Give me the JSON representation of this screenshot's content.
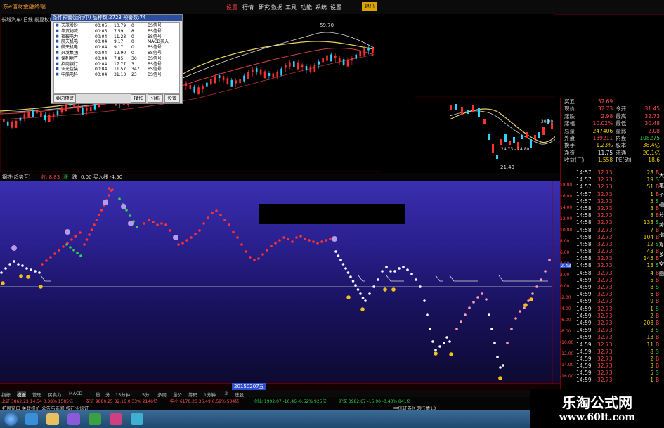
{
  "app": {
    "title": "东e信财金融终端",
    "window_button": "退出"
  },
  "menu": {
    "items": [
      "设置",
      "行情",
      "研究",
      "数据",
      "工具",
      "功能",
      "系统",
      "设置"
    ],
    "active_index": 0
  },
  "chart_top": {
    "title": "长城汽车(日线 前复权)",
    "high_label": "59.70",
    "low_label": "21.43",
    "range_label": "24.73 - 24.80",
    "price_labels": [
      "29.00"
    ]
  },
  "popup": {
    "title": "条件预警(运行中) 品种数:2723 预警数:74",
    "rows": [
      {
        "name": "天茂股份",
        "time": "00:05",
        "v1": "10.79",
        "v2": "0",
        "sig": "BS信号"
      },
      {
        "name": "华贸物流",
        "time": "00:05",
        "v1": "7.59",
        "v2": "8",
        "sig": "BS信号"
      },
      {
        "name": "福鞍电力",
        "time": "00:04",
        "v1": "11.23",
        "v2": "0",
        "sig": "BS信号"
      },
      {
        "name": "航天机电",
        "time": "00:04",
        "v1": "9.17",
        "v2": "0",
        "sig": "MACD买入"
      },
      {
        "name": "航天机电",
        "time": "00:04",
        "v1": "9.17",
        "v2": "0",
        "sig": "BS信号"
      },
      {
        "name": "兴发集团",
        "time": "00:04",
        "v1": "12.90",
        "v2": "0",
        "sig": "BS信号"
      },
      {
        "name": "保利地产",
        "time": "00:04",
        "v1": "7.85",
        "v2": "36",
        "sig": "BS信号"
      },
      {
        "name": "招商银行",
        "time": "00:04",
        "v1": "17.77",
        "v2": "3",
        "sig": "BS信号"
      },
      {
        "name": "亚光包装",
        "time": "00:04",
        "v1": "11.57",
        "v2": "347",
        "sig": "BS信号"
      },
      {
        "name": "中船电科",
        "time": "00:04",
        "v1": "31.13",
        "v2": "23",
        "sig": "BS信号"
      }
    ],
    "buttons": [
      "关闭预警",
      "操作",
      "分析",
      "设置"
    ]
  },
  "quote": [
    [
      "买五",
      "32.69",
      "",
      ""
    ],
    [
      "现价",
      "32.73",
      "今开",
      "31.45"
    ],
    [
      "涨跌",
      "2.98",
      "最高",
      "32.73"
    ],
    [
      "涨幅",
      "10.02%",
      "最低",
      "30.48"
    ],
    [
      "总量",
      "247406",
      "量比",
      "2.08"
    ],
    [
      "外盘",
      "139211",
      "内盘",
      "108275"
    ],
    [
      "换手",
      "1.23%",
      "股本",
      "38.4亿"
    ],
    [
      "净资",
      "11.75",
      "流通",
      "20.1亿"
    ],
    [
      "收益(三)",
      "1.558",
      "PE(动)",
      "18.6"
    ]
  ],
  "ticks": [
    [
      "14:57",
      "32.73",
      "28"
    ],
    [
      "14:57",
      "32.73",
      "19"
    ],
    [
      "14:57",
      "32.73",
      "51"
    ],
    [
      "14:57",
      "32.73",
      "1"
    ],
    [
      "14:57",
      "32.73",
      "5"
    ],
    [
      "14:58",
      "32.73",
      "3"
    ],
    [
      "14:58",
      "32.73",
      "8"
    ],
    [
      "14:58",
      "32.73",
      "133"
    ],
    [
      "14:58",
      "32.73",
      "7"
    ],
    [
      "14:58",
      "32.73",
      "104"
    ],
    [
      "14:58",
      "32.73",
      "12"
    ],
    [
      "14:58",
      "32.73",
      "43"
    ],
    [
      "14:58",
      "32.73",
      "145"
    ],
    [
      "14:58",
      "32.73",
      "13"
    ],
    [
      "14:58",
      "32.73",
      "4"
    ],
    [
      "14:59",
      "32.73",
      "5"
    ],
    [
      "14:59",
      "32.73",
      "8"
    ],
    [
      "14:59",
      "32.73",
      "6"
    ],
    [
      "14:59",
      "32.73",
      "9"
    ],
    [
      "14:59",
      "32.73",
      "1"
    ],
    [
      "14:59",
      "32.73",
      "2"
    ],
    [
      "14:59",
      "32.73",
      "208"
    ],
    [
      "14:59",
      "32.73",
      "3"
    ],
    [
      "14:59",
      "32.73",
      "13"
    ],
    [
      "14:59",
      "32.73",
      "11"
    ],
    [
      "14:59",
      "32.73",
      "8"
    ],
    [
      "14:59",
      "32.73",
      "2"
    ],
    [
      "14:59",
      "32.73",
      "3"
    ],
    [
      "14:59",
      "32.73",
      "5"
    ],
    [
      "14:59",
      "32.73",
      "1"
    ]
  ],
  "side_tabs": [
    "大",
    "笔",
    "价",
    "细",
    "分",
    "势",
    "指",
    "筹",
    "多",
    "空",
    "图"
  ],
  "indicator": {
    "title": "钢铁(趋势互)",
    "legend": [
      "收: 8.83",
      "涨",
      "跌"
    ],
    "extra": "0.00 买入线 -4.50",
    "y_labels": [
      "18.00",
      "16.00",
      "14.00",
      "12.00",
      "10.00",
      "8.00",
      "6.00",
      "4.00",
      "2.00",
      "0.00",
      "-2.00",
      "-4.00",
      "-6.00",
      "-8.00",
      "-10.00",
      "-12.00",
      "-14.00",
      "-16.00"
    ],
    "current_tag": "2.43"
  },
  "time_axis": {
    "date_tag": "20150207五"
  },
  "tabs": [
    "指标",
    "模板",
    "管理",
    "买卖力",
    "MACD",
    "量",
    "分",
    "15分钟",
    "5分",
    "多周",
    "量价",
    "筹码",
    "1分钟",
    "2",
    "选股"
  ],
  "index_row": [
    "上证 3862.23 14.54 0.38% 1585亿",
    "深证 9880.25 32.16 0.33% 2146亿",
    "中小 6178.26 36.49 0.59% 534亿",
    "创业 1992.07 -10.46 -0.52% 925亿",
    "沪深 3982.67 -15.90 -0.40% 841亿"
  ],
  "status": {
    "left": "扩展窗口 关联报价 公告与新闻 按行业诊证",
    "right": "中信证券长期行情13"
  },
  "watermark": {
    "title": "乐淘公式网",
    "url": "www.60lt.com"
  }
}
